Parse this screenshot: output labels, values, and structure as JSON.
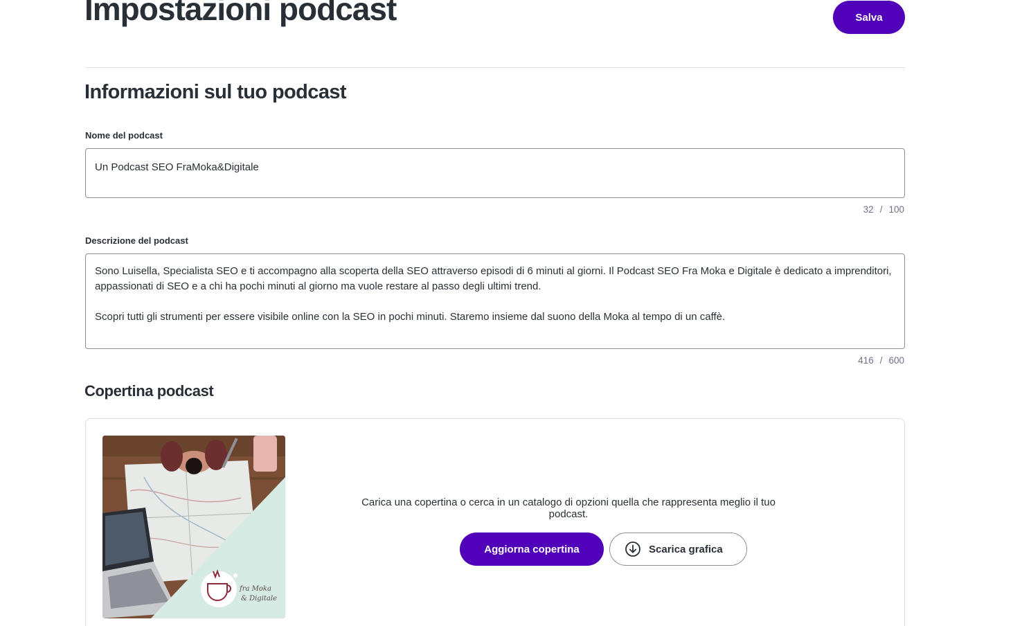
{
  "header": {
    "title": "Impostazioni podcast",
    "save_label": "Salva"
  },
  "info_section": {
    "title": "Informazioni sul tuo podcast",
    "name_field": {
      "label": "Nome del podcast",
      "value": "Un Podcast SEO FraMoka&Digitale",
      "count": "32",
      "separator": "/",
      "max": "100"
    },
    "description_field": {
      "label": "Descrizione del podcast",
      "paragraph_1": "Sono Luisella, Specialista SEO e ti accompagno alla scoperta della SEO attraverso episodi di 6 minuti al giorni. Il Podcast SEO Fra Moka e Digitale è dedicato a imprenditori, appassionati di SEO e a chi ha pochi minuti al giorno ma vuole restare al passo degli ultimi trend.",
      "paragraph_2": "Scopri tutti gli strumenti per essere visibile online con la SEO in pochi minuti. Staremo insieme dal suono della Moka al tempo di un caffè.",
      "count": "416",
      "separator": "/",
      "max": "600"
    }
  },
  "cover_section": {
    "title": "Copertina podcast",
    "description": "Carica una copertina o cerca in un catalogo di opzioni quella che rappresenta meglio il tuo podcast.",
    "update_label": "Aggiorna copertina",
    "download_label": "Scarica grafica",
    "download_icon": "download-circle-icon",
    "logo_text_line_1": "fra Moka",
    "logo_text_line_2": "& Digitale"
  },
  "colors": {
    "accent": "#5000b9",
    "text": "#292f36",
    "muted": "#6f7186",
    "border": "#8c8e94",
    "mint": "#d6ebe3"
  }
}
